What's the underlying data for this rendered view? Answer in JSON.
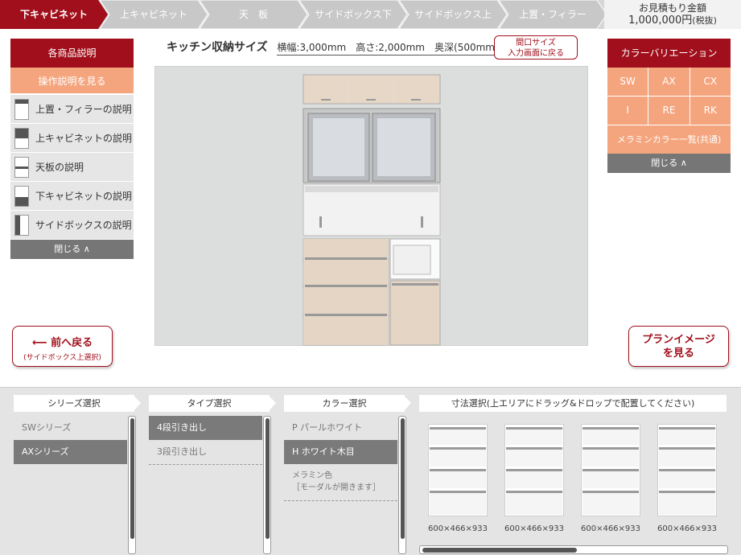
{
  "steps": [
    {
      "label": "下キャビネット",
      "active": true
    },
    {
      "label": "上キャビネット",
      "active": false
    },
    {
      "label": "天　板",
      "active": false
    },
    {
      "label": "サイドボックス下",
      "active": false
    },
    {
      "label": "サイドボックス上",
      "active": false
    },
    {
      "label": "上置・フィラー",
      "active": false
    }
  ],
  "price": {
    "label": "お見積もり金額",
    "value": "1,000,000円",
    "tax": "(税抜)"
  },
  "left_panel": {
    "title": "各商品説明",
    "howto": "操作説明を見る",
    "items": [
      "上置・フィラーの説明",
      "上キャビネットの説明",
      "天板の説明",
      "下キャビネットの説明",
      "サイドボックスの説明"
    ],
    "close": "閉じる ∧"
  },
  "size_info": {
    "title": "キッチン収納サイズ",
    "width": "横幅:3,000mm",
    "height": "高さ:2,000mm",
    "depth": "奥深(500mm)"
  },
  "back_size_button": {
    "line1": "間口サイズ",
    "line2": "入力画面に戻る"
  },
  "right_panel": {
    "title": "カラーバリエーション",
    "colors": [
      "SW",
      "AX",
      "CX",
      "I",
      "RE",
      "RK"
    ],
    "melamine": "メラミンカラー一覧(共通)",
    "close": "閉じる ∧"
  },
  "prev_button": {
    "label": "前へ戻る",
    "sub": "(サイドボックス上選択)"
  },
  "plan_button": {
    "line1": "プランイメージ",
    "line2": "を見る"
  },
  "bottom": {
    "series": {
      "title": "シリーズ選択",
      "options": [
        "SWシリーズ",
        "AXシリーズ"
      ],
      "selected": 1
    },
    "type": {
      "title": "タイプ選択",
      "options": [
        "4段引き出し",
        "3段引き出し"
      ],
      "selected": 0
    },
    "color": {
      "title": "カラー選択",
      "options": [
        "P パールホワイト",
        "H ホワイト木目"
      ],
      "melamine_line1": "メラミン色",
      "melamine_line2": "［モーダルが開きます］",
      "selected": 1
    },
    "size": {
      "title": "寸法選択(上エリアにドラッグ&ドロップで配置してください)",
      "items": [
        "600×466×933",
        "600×466×933",
        "600×466×933",
        "600×466×933"
      ]
    }
  },
  "colors": {
    "brand": "#a00f1b",
    "accent": "#f4a57e",
    "step_inactive": "#c8c8c8",
    "selected": "#7a7a7a"
  }
}
